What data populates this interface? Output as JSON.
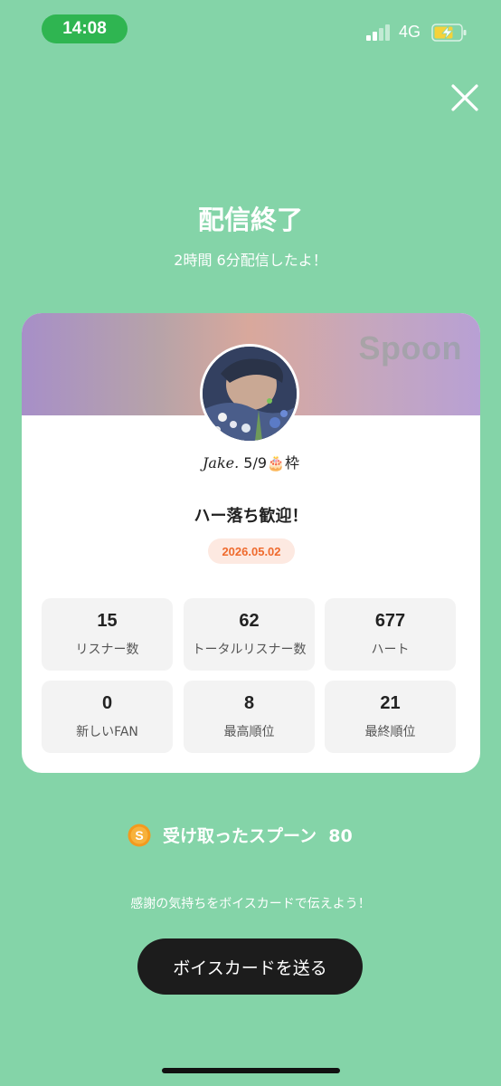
{
  "status": {
    "time": "14:08",
    "network": "4G",
    "battery_charging": true
  },
  "header": {
    "close_icon": "close-icon"
  },
  "title": "配信終了",
  "subtitle": "2時間 6分配信したよ！",
  "card": {
    "brand": "Spoon",
    "user_name": "Jake.",
    "user_suffix": "5/9🎂枠",
    "stream_title": "ハー落ち歓迎！",
    "date": "2026.05.02",
    "stats": [
      {
        "value": "15",
        "label": "リスナー数"
      },
      {
        "value": "62",
        "label": "トータルリスナー数"
      },
      {
        "value": "677",
        "label": "ハート"
      },
      {
        "value": "0",
        "label": "新しいFAN"
      },
      {
        "value": "8",
        "label": "最高順位"
      },
      {
        "value": "21",
        "label": "最終順位"
      }
    ]
  },
  "received": {
    "label": "受け取ったスプーン",
    "value": "80"
  },
  "thanks_text": "感謝の気持ちをボイスカードで伝えよう！",
  "voice_button": "ボイスカードを送る",
  "colors": {
    "background": "#84d4a8",
    "accent": "#ef6a2d",
    "time_pill": "#2fb551"
  }
}
